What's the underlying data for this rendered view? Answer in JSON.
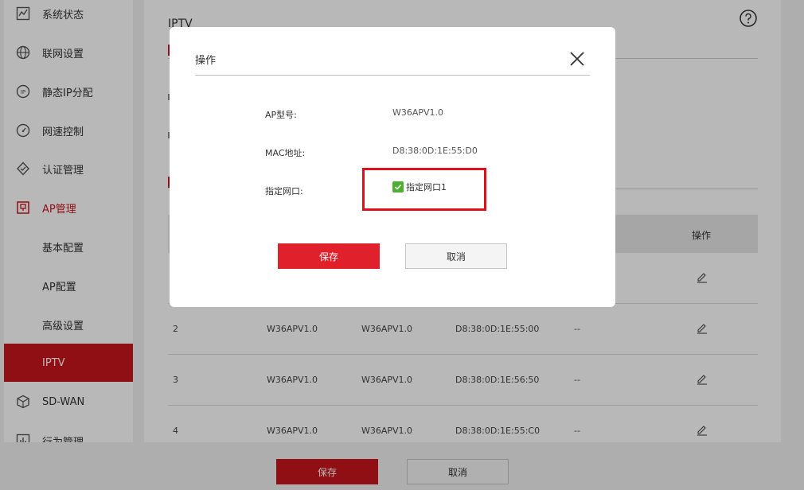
{
  "sidebar": {
    "items": [
      {
        "label": "系统状态",
        "icon": "chart-line-icon"
      },
      {
        "label": "联网设置",
        "icon": "globe-icon"
      },
      {
        "label": "静态IP分配",
        "icon": "ip-icon"
      },
      {
        "label": "网速控制",
        "icon": "speed-gauge-icon"
      },
      {
        "label": "认证管理",
        "icon": "shield-check-icon"
      },
      {
        "label": "AP管理",
        "icon": "ap-device-icon"
      },
      {
        "label": "基本配置"
      },
      {
        "label": "AP配置"
      },
      {
        "label": "高级设置"
      },
      {
        "label": "IPTV"
      },
      {
        "label": "SD-WAN",
        "icon": "cube-icon"
      },
      {
        "label": "行为管理",
        "icon": "bar-chart-icon"
      }
    ]
  },
  "main": {
    "title": "IPTV",
    "table": {
      "op_header": "操作",
      "rows": [
        {
          "index": "2",
          "model": "W36APV1.0",
          "version": "W36APV1.0",
          "mac": "D8:38:0D:1E:55:00",
          "port": "--"
        },
        {
          "index": "3",
          "model": "W36APV1.0",
          "version": "W36APV1.0",
          "mac": "D8:38:0D:1E:56:50",
          "port": "--"
        },
        {
          "index": "4",
          "model": "W36APV1.0",
          "version": "W36APV1.0",
          "mac": "D8:38:0D:1E:55:C0",
          "port": "--"
        }
      ]
    }
  },
  "footer": {
    "save_label": "保存",
    "cancel_label": "取消"
  },
  "modal": {
    "title": "操作",
    "fields": [
      {
        "label": "AP型号:",
        "value": "W36APV1.0"
      },
      {
        "label": "MAC地址:",
        "value": "D8:38:0D:1E:55:D0"
      },
      {
        "label": "指定网口:"
      }
    ],
    "checkbox_label": "指定网口1",
    "checkbox_checked": true,
    "save_label": "保存",
    "cancel_label": "取消"
  },
  "colors": {
    "accent": "#c8161d",
    "checkbox": "#4caf2f",
    "highlight": "#e0101a"
  }
}
